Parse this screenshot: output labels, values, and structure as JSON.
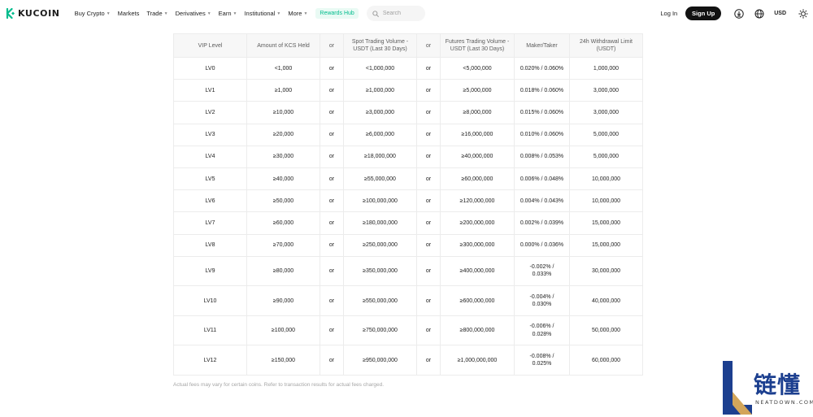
{
  "brand": {
    "name": "KUCOIN",
    "accent": "#01bc8d"
  },
  "nav": {
    "items": [
      {
        "label": "Buy Crypto",
        "dropdown": true
      },
      {
        "label": "Markets",
        "dropdown": false
      },
      {
        "label": "Trade",
        "dropdown": true
      },
      {
        "label": "Derivatives",
        "dropdown": true
      },
      {
        "label": "Earn",
        "dropdown": true
      },
      {
        "label": "Institutional",
        "dropdown": true
      },
      {
        "label": "More",
        "dropdown": true
      }
    ],
    "rewards": "Rewards Hub",
    "search_placeholder": "Search",
    "login": "Log In",
    "signup": "Sign Up",
    "currency": "USD"
  },
  "vip_table": {
    "headers": [
      "VIP Level",
      "Amount of KCS Held",
      "or",
      "Spot Trading Volume - USDT (Last 30 Days)",
      "or",
      "Futures Trading Volume - USDT (Last 30 Days)",
      "Maker/Taker",
      "24h Withdrawal Limit (USDT)"
    ],
    "rows": [
      [
        "LV0",
        "<1,000",
        "or",
        "<1,000,000",
        "or",
        "<5,000,000",
        "0.020% / 0.060%",
        "1,000,000"
      ],
      [
        "LV1",
        "≥1,000",
        "or",
        "≥1,000,000",
        "or",
        "≥5,000,000",
        "0.018% / 0.060%",
        "3,000,000"
      ],
      [
        "LV2",
        "≥10,000",
        "or",
        "≥3,000,000",
        "or",
        "≥8,000,000",
        "0.015% / 0.060%",
        "3,000,000"
      ],
      [
        "LV3",
        "≥20,000",
        "or",
        "≥6,000,000",
        "or",
        "≥16,000,000",
        "0.010% / 0.060%",
        "5,000,000"
      ],
      [
        "LV4",
        "≥30,000",
        "or",
        "≥18,000,000",
        "or",
        "≥40,000,000",
        "0.008% / 0.053%",
        "5,000,000"
      ],
      [
        "LV5",
        "≥40,000",
        "or",
        "≥55,000,000",
        "or",
        "≥60,000,000",
        "0.006% / 0.048%",
        "10,000,000"
      ],
      [
        "LV6",
        "≥50,000",
        "or",
        "≥100,000,000",
        "or",
        "≥120,000,000",
        "0.004% / 0.043%",
        "10,000,000"
      ],
      [
        "LV7",
        "≥60,000",
        "or",
        "≥180,000,000",
        "or",
        "≥200,000,000",
        "0.002% / 0.039%",
        "15,000,000"
      ],
      [
        "LV8",
        "≥70,000",
        "or",
        "≥250,000,000",
        "or",
        "≥300,000,000",
        "0.000% / 0.036%",
        "15,000,000"
      ],
      [
        "LV9",
        "≥80,000",
        "or",
        "≥350,000,000",
        "or",
        "≥400,000,000",
        "-0.002% / 0.033%",
        "30,000,000"
      ],
      [
        "LV10",
        "≥90,000",
        "or",
        "≥550,000,000",
        "or",
        "≥600,000,000",
        "-0.004% / 0.030%",
        "40,000,000"
      ],
      [
        "LV11",
        "≥100,000",
        "or",
        "≥750,000,000",
        "or",
        "≥800,000,000",
        "-0.006% / 0.028%",
        "50,000,000"
      ],
      [
        "LV12",
        "≥150,000",
        "or",
        "≥950,000,000",
        "or",
        "≥1,000,000,000",
        "-0.008% / 0.025%",
        "60,000,000"
      ]
    ],
    "note": "Actual fees may vary for certain coins. Refer to transaction results for actual fees charged."
  },
  "watermark": {
    "text": "链懂",
    "sub": "NEATDOWN.COM",
    "color": "#1c3f8f"
  }
}
